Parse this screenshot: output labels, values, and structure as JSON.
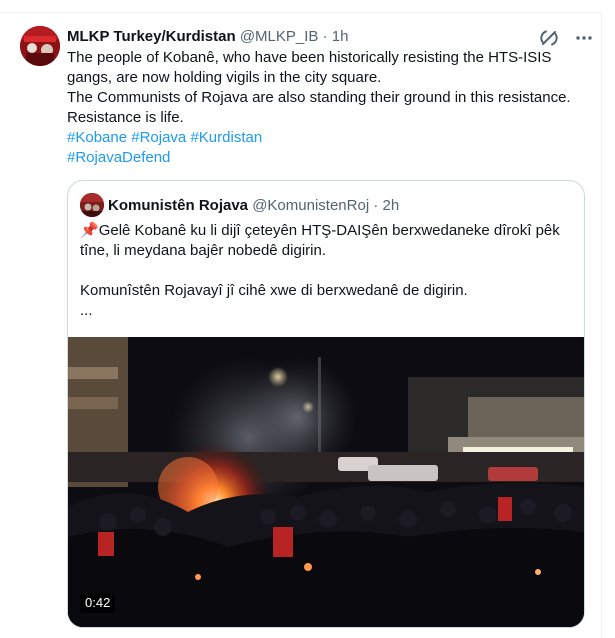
{
  "post": {
    "author_name": "MLKP Turkey/Kurdistan",
    "handle": "@MLKP_IB",
    "separator": "·",
    "time": "1h",
    "text_line1": "The people of Kobanê, who have been historically resisting the HTS-ISIS gangs, are now holding vigils in the city square.",
    "text_line2": "The Communists of Rojava are also standing their ground in this resistance.",
    "text_line3": "Resistance is life.",
    "hashtags": [
      "#Kobane",
      "#Rojava",
      "#Kurdistan",
      "#RojavaDefend"
    ]
  },
  "quoted": {
    "author_name": "Komunistên Rojava",
    "handle": "@KomunistenRoj",
    "separator": "·",
    "time": "2h",
    "pin_emoji": "📌",
    "text_line1": "Gelê Kobanê ku li dijî çeteyên HTŞ-DAIŞên berxwedaneke dîrokî pêk tîne, li meydana bajêr nobedê digirin.",
    "text_line2": "Komunîstên Rojavayî jî cihê xwe di berxwedanê de digirin.",
    "ellipsis": "...",
    "video_duration": "0:42"
  },
  "icons": {
    "grok": "grok-icon",
    "more": "more-options-icon"
  },
  "colors": {
    "link": "#1d9bf0",
    "muted": "#536471",
    "text": "#0f1419"
  }
}
